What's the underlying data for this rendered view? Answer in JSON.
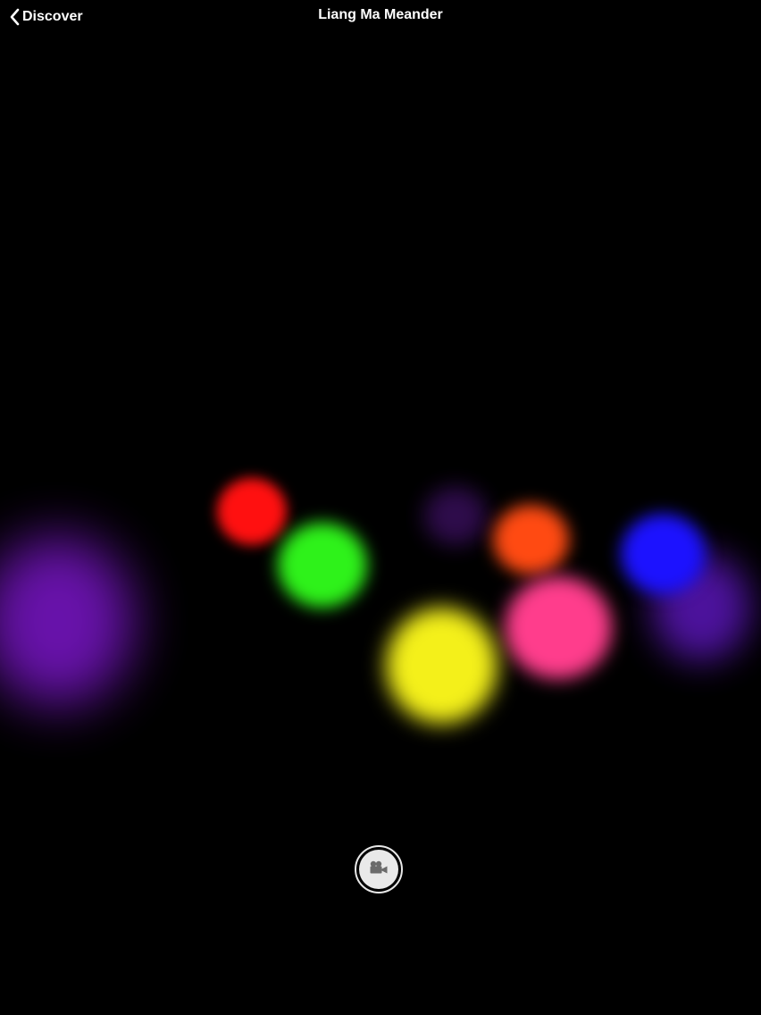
{
  "nav": {
    "back_label": "Discover",
    "title": "Liang Ma Meander"
  },
  "icons": {
    "back": "chevron-left-icon",
    "record": "video-camera-icon"
  },
  "orb_colors": {
    "purple_large": "#7a16c8",
    "red": "#ff1010",
    "green": "#2ef21a",
    "dark_purple": "#3a0f5e",
    "orange": "#ff4a12",
    "blue": "#1c12ff",
    "violet": "#5a16b8",
    "pink": "#ff3d8c",
    "yellow": "#f4f01a"
  }
}
